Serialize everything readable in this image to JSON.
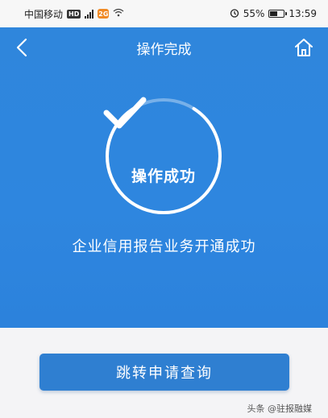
{
  "status_bar": {
    "carrier": "中国移动",
    "hd_badge": "HD",
    "network": "4G",
    "app_badge": "2G",
    "battery_text": "55%",
    "battery_level": 0.55,
    "time": "13:59"
  },
  "nav": {
    "title": "操作完成"
  },
  "result": {
    "status_label": "操作成功",
    "message": "企业信用报告业务开通成功",
    "progress_fraction": 0.82
  },
  "actions": {
    "primary_label": "跳转申请查询"
  },
  "watermark": {
    "text": "头条 @驻报融媒"
  },
  "colors": {
    "hero_blue": "#2f86dc",
    "button_blue": "#2f7fd1",
    "background": "#f4f4f6"
  },
  "icons": {
    "back": "chevron-left-icon",
    "home": "home-icon",
    "success": "checkmark-icon"
  }
}
